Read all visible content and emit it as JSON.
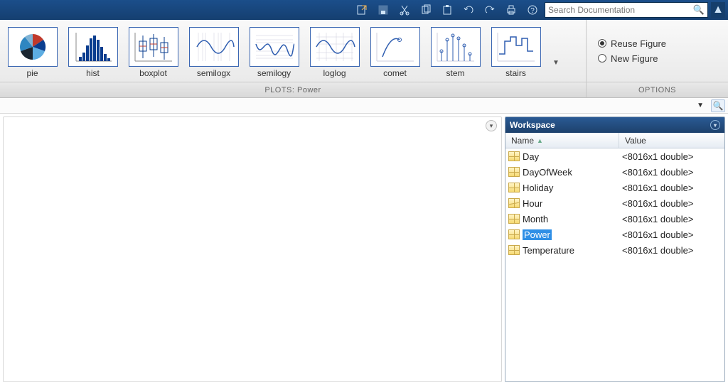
{
  "topbar": {
    "search_placeholder": "Search Documentation",
    "icons": [
      "export",
      "save",
      "cut",
      "copy",
      "paste",
      "undo",
      "redo",
      "print",
      "help"
    ]
  },
  "ribbon": {
    "plots_section_label": "PLOTS: Power",
    "options_section_label": "OPTIONS",
    "plot_types": [
      {
        "id": "pie",
        "label": "pie"
      },
      {
        "id": "hist",
        "label": "hist"
      },
      {
        "id": "boxplot",
        "label": "boxplot"
      },
      {
        "id": "semilogx",
        "label": "semilogx"
      },
      {
        "id": "semilogy",
        "label": "semilogy"
      },
      {
        "id": "loglog",
        "label": "loglog"
      },
      {
        "id": "comet",
        "label": "comet"
      },
      {
        "id": "stem",
        "label": "stem"
      },
      {
        "id": "stairs",
        "label": "stairs"
      }
    ],
    "options": {
      "reuse_label": "Reuse Figure",
      "new_label": "New Figure",
      "selected": "reuse"
    }
  },
  "workspace": {
    "title": "Workspace",
    "columns": {
      "name": "Name",
      "value": "Value"
    },
    "vars": [
      {
        "name": "Day",
        "value": "<8016x1 double>",
        "selected": false
      },
      {
        "name": "DayOfWeek",
        "value": "<8016x1 double>",
        "selected": false
      },
      {
        "name": "Holiday",
        "value": "<8016x1 double>",
        "selected": false
      },
      {
        "name": "Hour",
        "value": "<8016x1 double>",
        "selected": false,
        "cursor": true
      },
      {
        "name": "Month",
        "value": "<8016x1 double>",
        "selected": false
      },
      {
        "name": "Power",
        "value": "<8016x1 double>",
        "selected": true
      },
      {
        "name": "Temperature",
        "value": "<8016x1 double>",
        "selected": false
      }
    ]
  }
}
